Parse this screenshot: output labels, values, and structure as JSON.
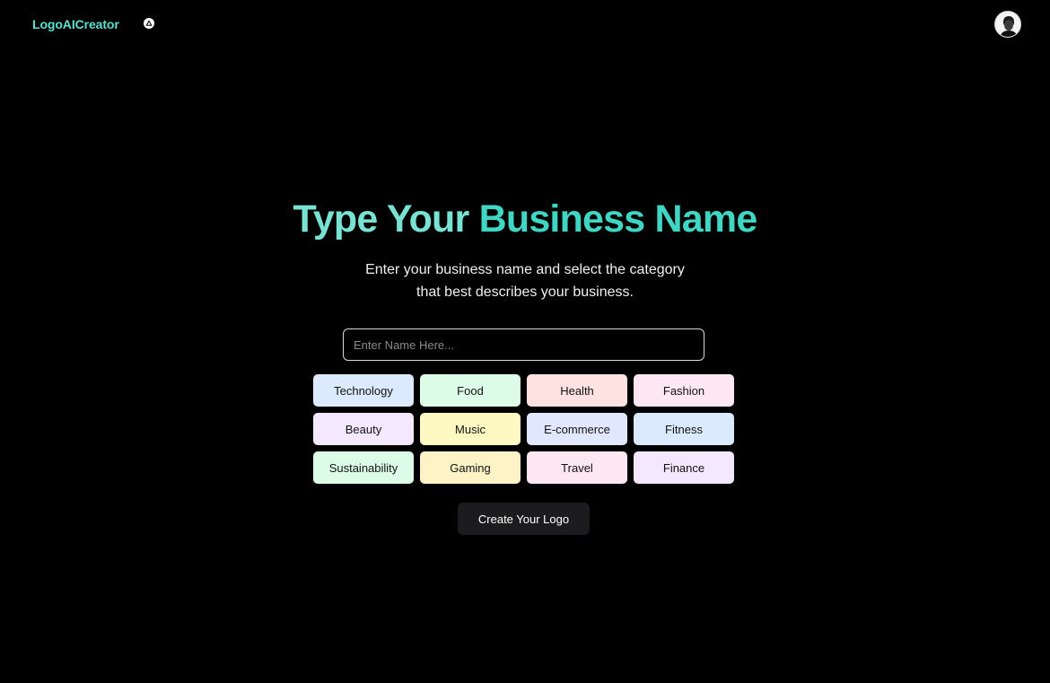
{
  "header": {
    "brand": "LogoAICreator",
    "deploy_icon": "triangle-icon",
    "avatar_icon": "user-avatar"
  },
  "hero": {
    "title_part1": "Type Your ",
    "title_part2": "Business Name",
    "subtitle_line1": "Enter your business name and select the category",
    "subtitle_line2": "that best describes your business."
  },
  "form": {
    "name_value": "",
    "name_placeholder": "Enter Name Here...",
    "categories": [
      {
        "label": "Technology",
        "color": "#dbeafe"
      },
      {
        "label": "Food",
        "color": "#dcfce7"
      },
      {
        "label": "Health",
        "color": "#fee2e2"
      },
      {
        "label": "Fashion",
        "color": "#fce7f3"
      },
      {
        "label": "Beauty",
        "color": "#f3e8ff"
      },
      {
        "label": "Music",
        "color": "#fef9c3"
      },
      {
        "label": "E-commerce",
        "color": "#e0e7ff"
      },
      {
        "label": "Fitness",
        "color": "#dbeafe"
      },
      {
        "label": "Sustainability",
        "color": "#dcfce7"
      },
      {
        "label": "Gaming",
        "color": "#fef3c7"
      },
      {
        "label": "Travel",
        "color": "#fce7f3"
      },
      {
        "label": "Finance",
        "color": "#f3e8ff"
      }
    ],
    "submit_label": "Create Your Logo"
  },
  "colors": {
    "background": "#000000",
    "brand": "#5ce0cf",
    "title_light": "#79e3d3",
    "title_accent": "#3fd6c4",
    "button_dark": "#1c1c1e"
  }
}
